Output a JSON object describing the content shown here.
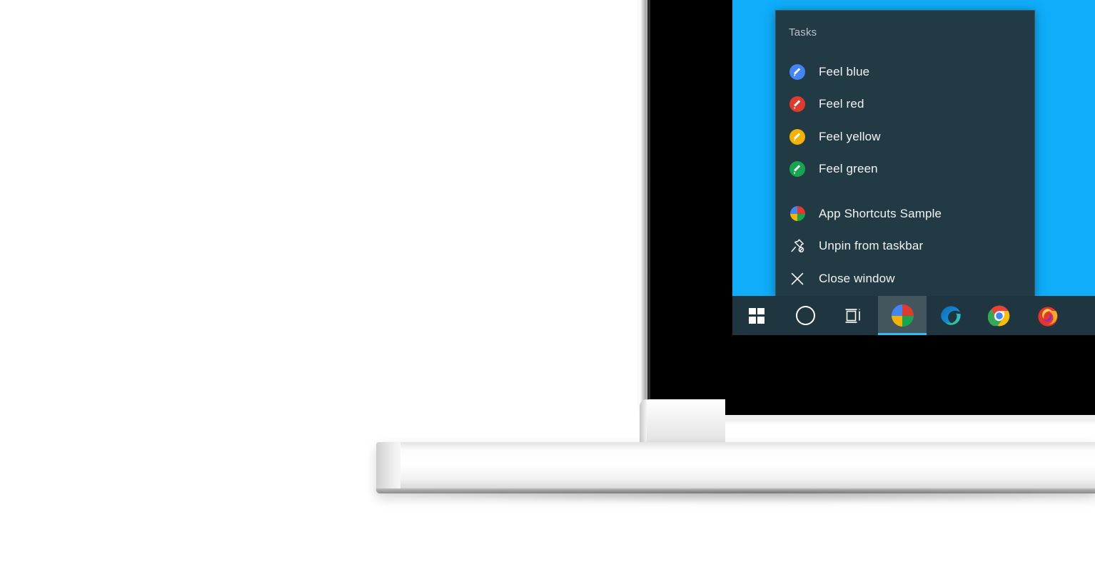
{
  "theme": {
    "wallpaper_color": "#0fadfa",
    "menu_background": "#223a44",
    "menu_border": "#3a545e",
    "taskbar_background": "#1f3640",
    "accent_underline": "#33bdf7",
    "menu_text_color": "#f2f4f5",
    "menu_header_color": "#b9c4c9"
  },
  "jumplist": {
    "header": "Tasks",
    "tasks": [
      {
        "label": "Feel blue",
        "icon": "pencil-circle-icon",
        "color": "#4285f4"
      },
      {
        "label": "Feel red",
        "icon": "pencil-circle-icon",
        "color": "#e03a2f"
      },
      {
        "label": "Feel yellow",
        "icon": "pencil-circle-icon",
        "color": "#f5b200"
      },
      {
        "label": "Feel green",
        "icon": "pencil-circle-icon",
        "color": "#18a551"
      }
    ],
    "system_items": [
      {
        "label": "App Shortcuts Sample",
        "icon": "app-pie-icon"
      },
      {
        "label": "Unpin from taskbar",
        "icon": "unpin-icon"
      },
      {
        "label": "Close window",
        "icon": "close-icon"
      }
    ]
  },
  "taskbar": {
    "items": [
      {
        "name": "start-button",
        "icon": "windows-logo-icon",
        "label": "Start",
        "active": false
      },
      {
        "name": "cortana-search-button",
        "icon": "cortana-circle-icon",
        "label": "Cortana",
        "active": false
      },
      {
        "name": "task-view-button",
        "icon": "task-view-icon",
        "label": "Task View",
        "active": false
      },
      {
        "name": "app-shortcuts-sample-button",
        "icon": "app-pie-icon",
        "label": "App Shortcuts Sample",
        "active": true
      },
      {
        "name": "microsoft-edge-button",
        "icon": "edge-icon",
        "label": "Microsoft Edge",
        "active": false
      },
      {
        "name": "google-chrome-button",
        "icon": "chrome-icon",
        "label": "Google Chrome",
        "active": false
      },
      {
        "name": "firefox-button",
        "icon": "firefox-icon",
        "label": "Mozilla Firefox",
        "active": false
      }
    ]
  },
  "app_pie_colors": {
    "top_left": "#4285f4",
    "top_right": "#e03a2f",
    "bottom_left": "#f5b200",
    "bottom_right": "#18a551"
  },
  "device": {
    "type": "laptop-mockup",
    "bezel_color": "#000000",
    "chassis_color": "#f2f2f2"
  }
}
